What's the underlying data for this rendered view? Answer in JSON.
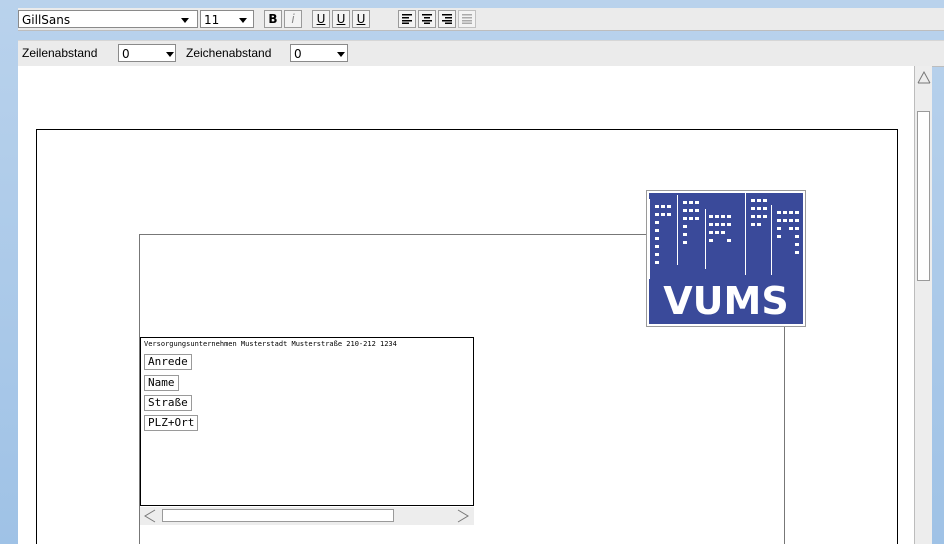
{
  "toolbar1": {
    "font_family": "GillSans",
    "font_size": "11",
    "buttons": {
      "bold": "B",
      "italic": "i",
      "underline1": "U",
      "underline2": "U",
      "underline3": "U"
    },
    "icons": [
      "align-left-icon",
      "align-center-icon",
      "align-right-icon",
      "align-justify-icon"
    ]
  },
  "toolbar2": {
    "line_spacing_label": "Zeilenabstand",
    "line_spacing_value": "0",
    "char_spacing_label": "Zeichenabstand",
    "char_spacing_value": "0"
  },
  "document": {
    "logo_text": "VUMS",
    "sender_line": "Versorgungsunternehmen Musterstadt Musterstraße 210-212 1234",
    "fields": [
      "Anrede",
      "Name",
      "Straße",
      "PLZ+Ort"
    ]
  },
  "colors": {
    "logo_blue": "#3a4a9a",
    "window_background": "#8eb6de"
  }
}
